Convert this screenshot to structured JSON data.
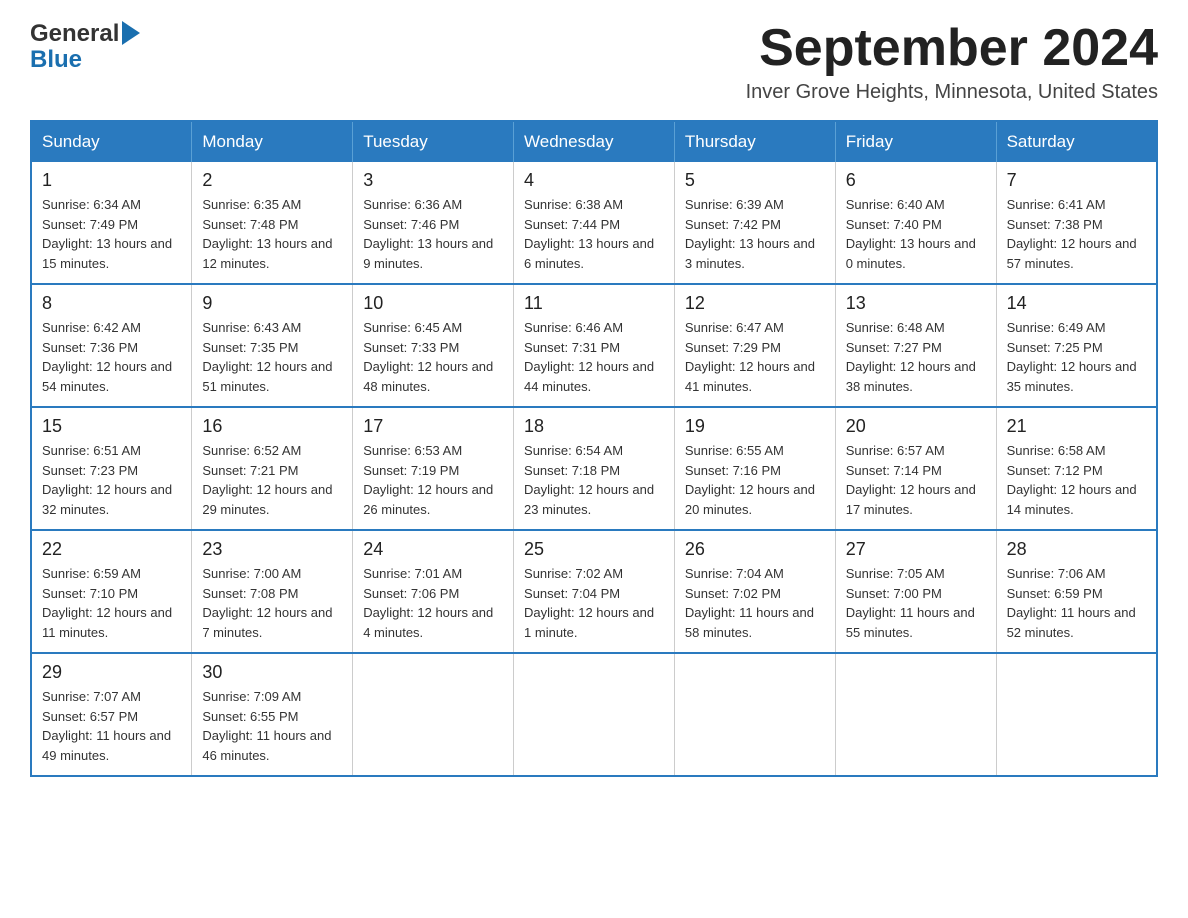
{
  "header": {
    "logo_general": "General",
    "logo_blue": "Blue",
    "month_title": "September 2024",
    "subtitle": "Inver Grove Heights, Minnesota, United States"
  },
  "calendar": {
    "days_of_week": [
      "Sunday",
      "Monday",
      "Tuesday",
      "Wednesday",
      "Thursday",
      "Friday",
      "Saturday"
    ],
    "weeks": [
      [
        {
          "day": "1",
          "sunrise": "Sunrise: 6:34 AM",
          "sunset": "Sunset: 7:49 PM",
          "daylight": "Daylight: 13 hours and 15 minutes."
        },
        {
          "day": "2",
          "sunrise": "Sunrise: 6:35 AM",
          "sunset": "Sunset: 7:48 PM",
          "daylight": "Daylight: 13 hours and 12 minutes."
        },
        {
          "day": "3",
          "sunrise": "Sunrise: 6:36 AM",
          "sunset": "Sunset: 7:46 PM",
          "daylight": "Daylight: 13 hours and 9 minutes."
        },
        {
          "day": "4",
          "sunrise": "Sunrise: 6:38 AM",
          "sunset": "Sunset: 7:44 PM",
          "daylight": "Daylight: 13 hours and 6 minutes."
        },
        {
          "day": "5",
          "sunrise": "Sunrise: 6:39 AM",
          "sunset": "Sunset: 7:42 PM",
          "daylight": "Daylight: 13 hours and 3 minutes."
        },
        {
          "day": "6",
          "sunrise": "Sunrise: 6:40 AM",
          "sunset": "Sunset: 7:40 PM",
          "daylight": "Daylight: 13 hours and 0 minutes."
        },
        {
          "day": "7",
          "sunrise": "Sunrise: 6:41 AM",
          "sunset": "Sunset: 7:38 PM",
          "daylight": "Daylight: 12 hours and 57 minutes."
        }
      ],
      [
        {
          "day": "8",
          "sunrise": "Sunrise: 6:42 AM",
          "sunset": "Sunset: 7:36 PM",
          "daylight": "Daylight: 12 hours and 54 minutes."
        },
        {
          "day": "9",
          "sunrise": "Sunrise: 6:43 AM",
          "sunset": "Sunset: 7:35 PM",
          "daylight": "Daylight: 12 hours and 51 minutes."
        },
        {
          "day": "10",
          "sunrise": "Sunrise: 6:45 AM",
          "sunset": "Sunset: 7:33 PM",
          "daylight": "Daylight: 12 hours and 48 minutes."
        },
        {
          "day": "11",
          "sunrise": "Sunrise: 6:46 AM",
          "sunset": "Sunset: 7:31 PM",
          "daylight": "Daylight: 12 hours and 44 minutes."
        },
        {
          "day": "12",
          "sunrise": "Sunrise: 6:47 AM",
          "sunset": "Sunset: 7:29 PM",
          "daylight": "Daylight: 12 hours and 41 minutes."
        },
        {
          "day": "13",
          "sunrise": "Sunrise: 6:48 AM",
          "sunset": "Sunset: 7:27 PM",
          "daylight": "Daylight: 12 hours and 38 minutes."
        },
        {
          "day": "14",
          "sunrise": "Sunrise: 6:49 AM",
          "sunset": "Sunset: 7:25 PM",
          "daylight": "Daylight: 12 hours and 35 minutes."
        }
      ],
      [
        {
          "day": "15",
          "sunrise": "Sunrise: 6:51 AM",
          "sunset": "Sunset: 7:23 PM",
          "daylight": "Daylight: 12 hours and 32 minutes."
        },
        {
          "day": "16",
          "sunrise": "Sunrise: 6:52 AM",
          "sunset": "Sunset: 7:21 PM",
          "daylight": "Daylight: 12 hours and 29 minutes."
        },
        {
          "day": "17",
          "sunrise": "Sunrise: 6:53 AM",
          "sunset": "Sunset: 7:19 PM",
          "daylight": "Daylight: 12 hours and 26 minutes."
        },
        {
          "day": "18",
          "sunrise": "Sunrise: 6:54 AM",
          "sunset": "Sunset: 7:18 PM",
          "daylight": "Daylight: 12 hours and 23 minutes."
        },
        {
          "day": "19",
          "sunrise": "Sunrise: 6:55 AM",
          "sunset": "Sunset: 7:16 PM",
          "daylight": "Daylight: 12 hours and 20 minutes."
        },
        {
          "day": "20",
          "sunrise": "Sunrise: 6:57 AM",
          "sunset": "Sunset: 7:14 PM",
          "daylight": "Daylight: 12 hours and 17 minutes."
        },
        {
          "day": "21",
          "sunrise": "Sunrise: 6:58 AM",
          "sunset": "Sunset: 7:12 PM",
          "daylight": "Daylight: 12 hours and 14 minutes."
        }
      ],
      [
        {
          "day": "22",
          "sunrise": "Sunrise: 6:59 AM",
          "sunset": "Sunset: 7:10 PM",
          "daylight": "Daylight: 12 hours and 11 minutes."
        },
        {
          "day": "23",
          "sunrise": "Sunrise: 7:00 AM",
          "sunset": "Sunset: 7:08 PM",
          "daylight": "Daylight: 12 hours and 7 minutes."
        },
        {
          "day": "24",
          "sunrise": "Sunrise: 7:01 AM",
          "sunset": "Sunset: 7:06 PM",
          "daylight": "Daylight: 12 hours and 4 minutes."
        },
        {
          "day": "25",
          "sunrise": "Sunrise: 7:02 AM",
          "sunset": "Sunset: 7:04 PM",
          "daylight": "Daylight: 12 hours and 1 minute."
        },
        {
          "day": "26",
          "sunrise": "Sunrise: 7:04 AM",
          "sunset": "Sunset: 7:02 PM",
          "daylight": "Daylight: 11 hours and 58 minutes."
        },
        {
          "day": "27",
          "sunrise": "Sunrise: 7:05 AM",
          "sunset": "Sunset: 7:00 PM",
          "daylight": "Daylight: 11 hours and 55 minutes."
        },
        {
          "day": "28",
          "sunrise": "Sunrise: 7:06 AM",
          "sunset": "Sunset: 6:59 PM",
          "daylight": "Daylight: 11 hours and 52 minutes."
        }
      ],
      [
        {
          "day": "29",
          "sunrise": "Sunrise: 7:07 AM",
          "sunset": "Sunset: 6:57 PM",
          "daylight": "Daylight: 11 hours and 49 minutes."
        },
        {
          "day": "30",
          "sunrise": "Sunrise: 7:09 AM",
          "sunset": "Sunset: 6:55 PM",
          "daylight": "Daylight: 11 hours and 46 minutes."
        },
        null,
        null,
        null,
        null,
        null
      ]
    ]
  }
}
